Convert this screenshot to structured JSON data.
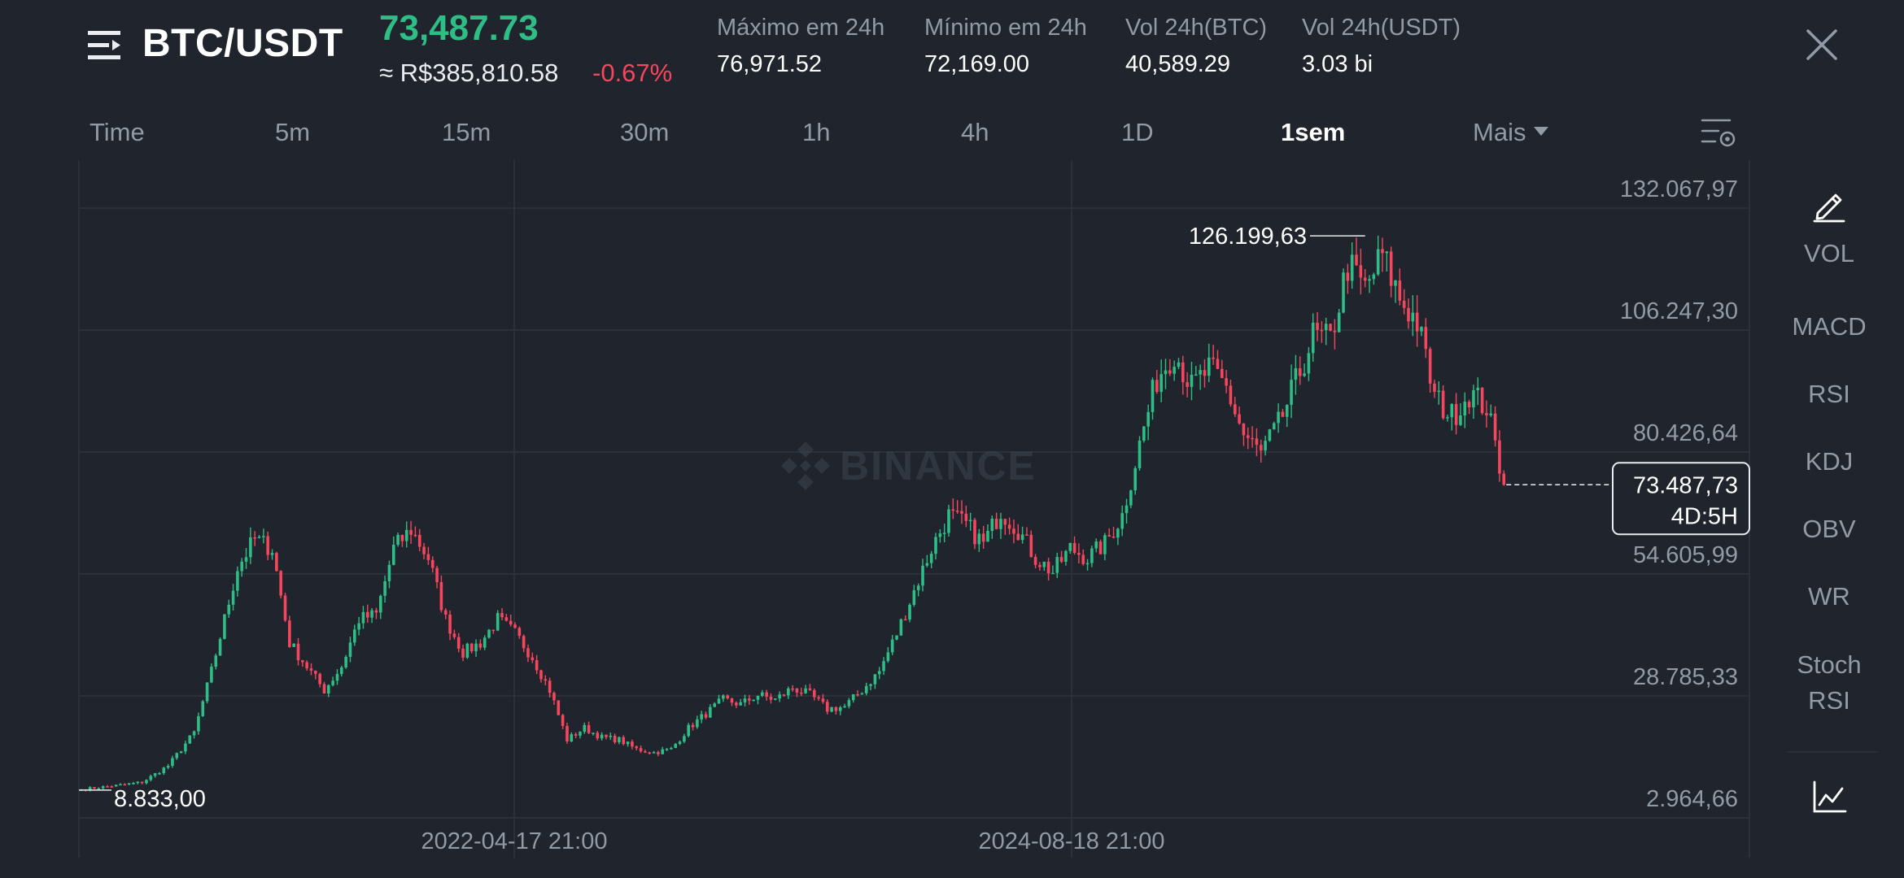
{
  "header": {
    "pair": "BTC/USDT",
    "price": "73,487.73",
    "fiat_price": "≈ R$385,810.58",
    "change": "-0.67%",
    "stats": [
      {
        "label": "Máximo em 24h",
        "value": "76,971.52"
      },
      {
        "label": "Mínimo em 24h",
        "value": "72,169.00"
      },
      {
        "label": "Vol 24h(BTC)",
        "value": "40,589.29"
      },
      {
        "label": "Vol 24h(USDT)",
        "value": "3.03 bi"
      }
    ]
  },
  "timeframes": {
    "items": [
      "Time",
      "5m",
      "15m",
      "30m",
      "1h",
      "4h",
      "1D",
      "1sem",
      "Mais"
    ],
    "active": "1sem"
  },
  "side_panel": {
    "items": [
      "VOL",
      "MACD",
      "RSI",
      "KDJ",
      "OBV",
      "WR",
      "Stoch RSI"
    ]
  },
  "icons": {
    "menu": "menu-icon",
    "close": "close-icon",
    "settings": "chart-settings-icon",
    "draw": "pencil-icon",
    "chart_type": "line-chart-icon"
  },
  "colors": {
    "up": "#2ebd85",
    "down": "#f6465d",
    "background": "#1f242d",
    "grid": "#2b3139",
    "text_muted": "#929aa5"
  },
  "chart_data": {
    "type": "candlestick",
    "watermark": "BINANCE",
    "y_ticks": [
      "132.067,97",
      "106.247,30",
      "80.426,64",
      "54.605,99",
      "28.785,33",
      "2.964,66"
    ],
    "y_tick_values": [
      132067.97,
      106247.3,
      80426.64,
      54605.99,
      28785.33,
      2964.66
    ],
    "x_ticks": [
      "2022-04-17 21:00",
      "2024-08-18 21:00"
    ],
    "high_label": "126.199,63",
    "low_label": "8.833,00",
    "high_value": 126199.63,
    "low_value": 8833.0,
    "current_price_label": "73.487,73",
    "current_value": 73487.73,
    "countdown": "4D:5H",
    "grid": true,
    "keyframes": [
      [
        0,
        9000
      ],
      [
        8,
        9800
      ],
      [
        14,
        10500
      ],
      [
        20,
        14000
      ],
      [
        26,
        21000
      ],
      [
        30,
        34000
      ],
      [
        36,
        56000
      ],
      [
        40,
        62000
      ],
      [
        44,
        60000
      ],
      [
        48,
        40000
      ],
      [
        52,
        35000
      ],
      [
        56,
        30000
      ],
      [
        60,
        35000
      ],
      [
        64,
        45000
      ],
      [
        68,
        46000
      ],
      [
        72,
        60000
      ],
      [
        76,
        64000
      ],
      [
        80,
        58000
      ],
      [
        84,
        45000
      ],
      [
        88,
        38000
      ],
      [
        92,
        40000
      ],
      [
        96,
        45000
      ],
      [
        100,
        42000
      ],
      [
        104,
        37000
      ],
      [
        108,
        30000
      ],
      [
        112,
        19500
      ],
      [
        116,
        22000
      ],
      [
        120,
        20000
      ],
      [
        124,
        19500
      ],
      [
        128,
        17500
      ],
      [
        132,
        16800
      ],
      [
        136,
        17500
      ],
      [
        140,
        22000
      ],
      [
        144,
        25000
      ],
      [
        148,
        28000
      ],
      [
        152,
        27000
      ],
      [
        156,
        29000
      ],
      [
        160,
        28000
      ],
      [
        164,
        30500
      ],
      [
        168,
        29000
      ],
      [
        172,
        26000
      ],
      [
        176,
        26500
      ],
      [
        180,
        30000
      ],
      [
        184,
        34000
      ],
      [
        188,
        42000
      ],
      [
        192,
        51000
      ],
      [
        196,
        60000
      ],
      [
        200,
        67000
      ],
      [
        204,
        65000
      ],
      [
        208,
        61000
      ],
      [
        212,
        68000
      ],
      [
        216,
        64000
      ],
      [
        220,
        58000
      ],
      [
        224,
        55000
      ],
      [
        228,
        60000
      ],
      [
        232,
        58000
      ],
      [
        236,
        61000
      ],
      [
        240,
        67000
      ],
      [
        244,
        82000
      ],
      [
        248,
        96000
      ],
      [
        252,
        102000
      ],
      [
        256,
        94000
      ],
      [
        260,
        98000
      ],
      [
        264,
        94000
      ],
      [
        268,
        84000
      ],
      [
        272,
        80000
      ],
      [
        276,
        86000
      ],
      [
        280,
        95000
      ],
      [
        284,
        105000
      ],
      [
        288,
        104000
      ],
      [
        292,
        120000
      ],
      [
        296,
        115000
      ],
      [
        300,
        122000
      ],
      [
        304,
        113000
      ],
      [
        308,
        108000
      ],
      [
        312,
        92000
      ],
      [
        316,
        88000
      ],
      [
        320,
        93000
      ],
      [
        324,
        90000
      ],
      [
        328,
        73487.73
      ]
    ]
  }
}
